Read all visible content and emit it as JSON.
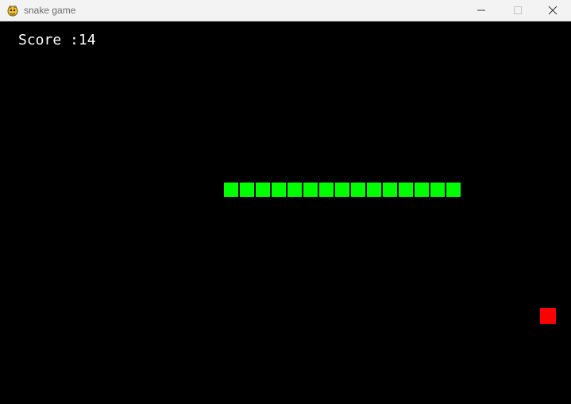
{
  "window": {
    "title": "snake game",
    "app_icon": "pygame-snake-icon",
    "controls": {
      "minimize_icon": "minimize-icon",
      "maximize_icon": "maximize-icon",
      "close_icon": "close-icon"
    }
  },
  "game": {
    "score_text": "Score :14",
    "score": 14,
    "background_color": "#000000",
    "snake_color": "#00ff00",
    "food_color": "#ff0000",
    "snake_segment_count": 15,
    "direction_hint": "horizontal"
  }
}
